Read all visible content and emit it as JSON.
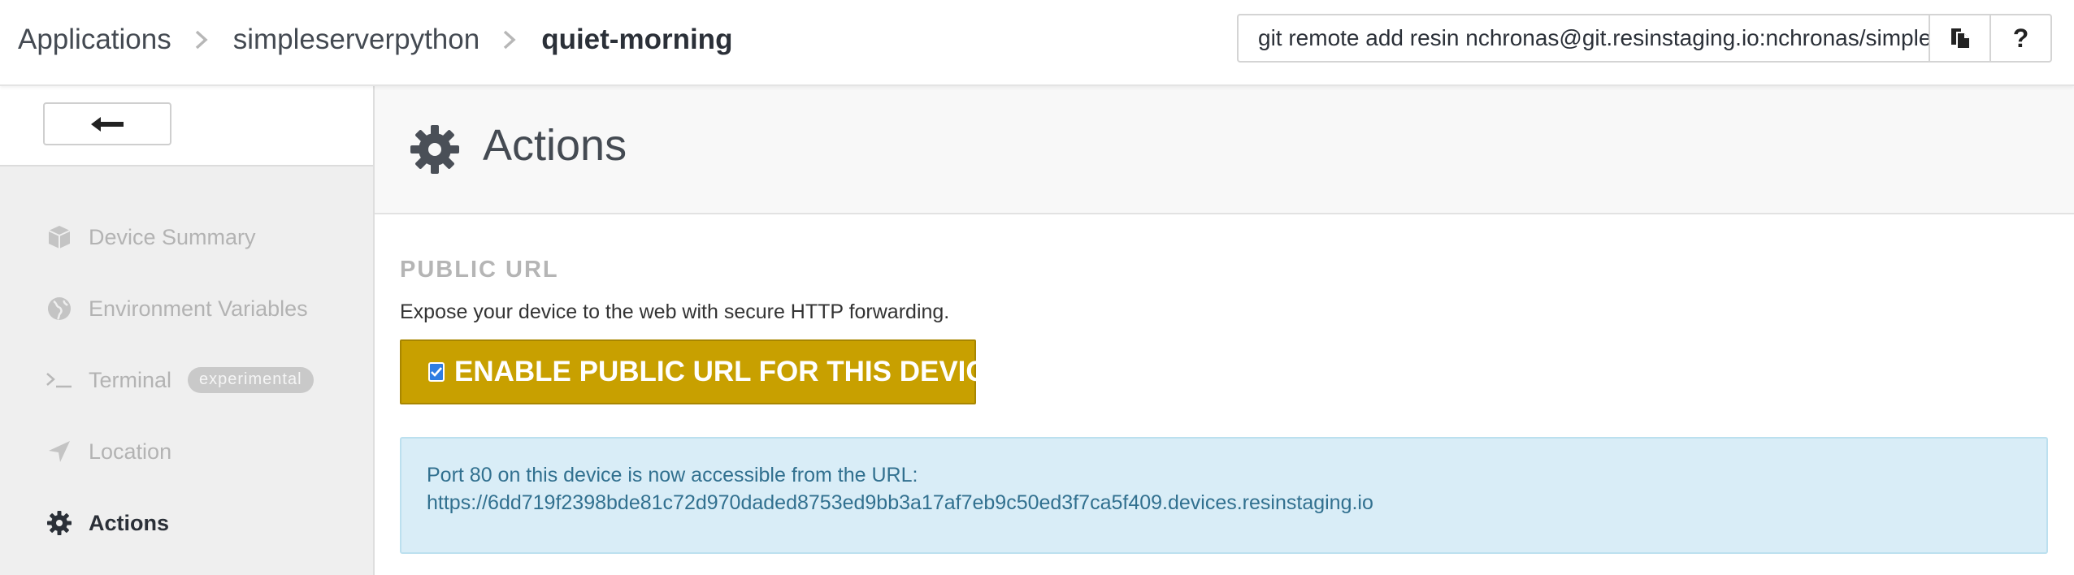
{
  "breadcrumb": {
    "items": [
      "Applications",
      "simpleserverpython",
      "quiet-morning"
    ]
  },
  "git_remote": {
    "value": "git remote add resin nchronas@git.resinstaging.io:nchronas/simpleserverpython.git"
  },
  "toolbar": {
    "copy_icon": "copy-icon",
    "help_label": "?"
  },
  "sidebar": {
    "back_icon": "arrow-left-icon",
    "items": [
      {
        "label": "Device Summary",
        "icon": "cube-icon",
        "active": false
      },
      {
        "label": "Environment Variables",
        "icon": "globe-icon",
        "active": false
      },
      {
        "label": "Terminal",
        "icon": "terminal-icon",
        "badge": "experimental",
        "active": false
      },
      {
        "label": "Location",
        "icon": "location-arrow-icon",
        "active": false
      },
      {
        "label": "Actions",
        "icon": "gear-icon",
        "active": true
      }
    ]
  },
  "main": {
    "title": "Actions",
    "section_title": "PUBLIC URL",
    "section_desc": "Expose your device to the web with secure HTTP forwarding.",
    "enable_button": {
      "label": "ENABLE PUBLIC URL FOR THIS DEVICE",
      "checked": true
    },
    "info": {
      "line1": "Port 80 on this device is now accessible from the URL:",
      "url": "https://6dd719f2398bde81c72d970daded8753ed9bb3a17af7eb9c50ed3f7ca5f409.devices.resinstaging.io"
    }
  },
  "colors": {
    "accent_button": "#c8a000",
    "info_bg": "#d9edf7",
    "info_text": "#31708f",
    "checkbox": "#2f7de1"
  }
}
